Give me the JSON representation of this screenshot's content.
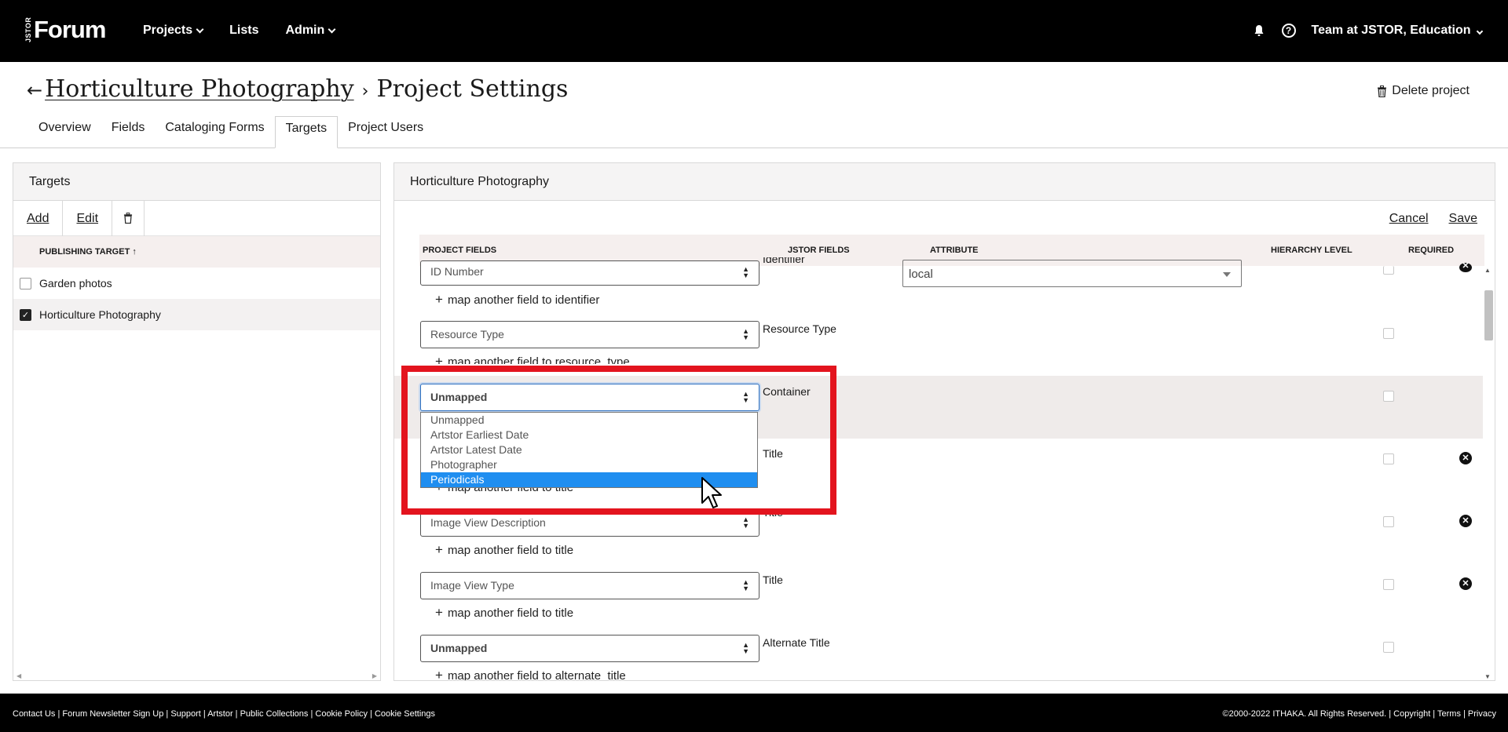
{
  "nav": {
    "logo_small": "JSTOR",
    "logo": "Forum",
    "items": [
      "Projects",
      "Lists",
      "Admin"
    ],
    "help": "?",
    "user": "Team at JSTOR, Education"
  },
  "header": {
    "back": "←",
    "project": "Horticulture Photography",
    "separator": "›",
    "page": "Project Settings",
    "delete": "Delete project",
    "tabs": [
      "Overview",
      "Fields",
      "Cataloging Forms",
      "Targets",
      "Project Users"
    ],
    "active_tab": "Targets"
  },
  "targets_panel": {
    "title": "Targets",
    "toolbar": {
      "add": "Add",
      "edit": "Edit"
    },
    "column": "PUBLISHING TARGET",
    "rows": [
      {
        "label": "Garden photos",
        "checked": false
      },
      {
        "label": "Horticulture Photography",
        "checked": true
      }
    ]
  },
  "mapping_panel": {
    "title": "Horticulture Photography",
    "cancel": "Cancel",
    "save": "Save",
    "columns": [
      "PROJECT FIELDS",
      "JSTOR FIELDS",
      "ATTRIBUTE",
      "HIERARCHY LEVEL",
      "REQUIRED"
    ],
    "rows": [
      {
        "project_field": "ID Number",
        "jstor_field": "Identifier",
        "attribute": "local",
        "add_link": "map another field to identifier"
      },
      {
        "project_field": "Resource Type",
        "jstor_field": "Resource Type",
        "add_link": "map another field to resource_type"
      },
      {
        "project_field": "Unmapped",
        "jstor_field": "Container"
      },
      {
        "project_field": "",
        "jstor_field": "Title",
        "add_link": "map another field to title"
      },
      {
        "project_field": "Image View Description",
        "jstor_field": "Title",
        "add_link": "map another field to title"
      },
      {
        "project_field": "Image View Type",
        "jstor_field": "Title",
        "add_link": "map another field to title"
      },
      {
        "project_field": "Unmapped",
        "jstor_field": "Alternate Title",
        "add_link": "map another field to alternate_title"
      }
    ],
    "dropdown_options": [
      "Unmapped",
      "Artstor Earliest Date",
      "Artstor Latest Date",
      "Photographer",
      "Periodicals"
    ],
    "dropdown_highlighted": "Periodicals"
  },
  "footer": {
    "left": "Contact Us | Forum Newsletter Sign Up | Support | Artstor | Public Collections | Cookie Policy |  Cookie Settings",
    "right": "©2000-2022 ITHAKA. All Rights Reserved. | Copyright | Terms | Privacy"
  },
  "colors": {
    "highlight_frame": "#e3141e",
    "dropdown_highlight": "#1f8ef0"
  }
}
